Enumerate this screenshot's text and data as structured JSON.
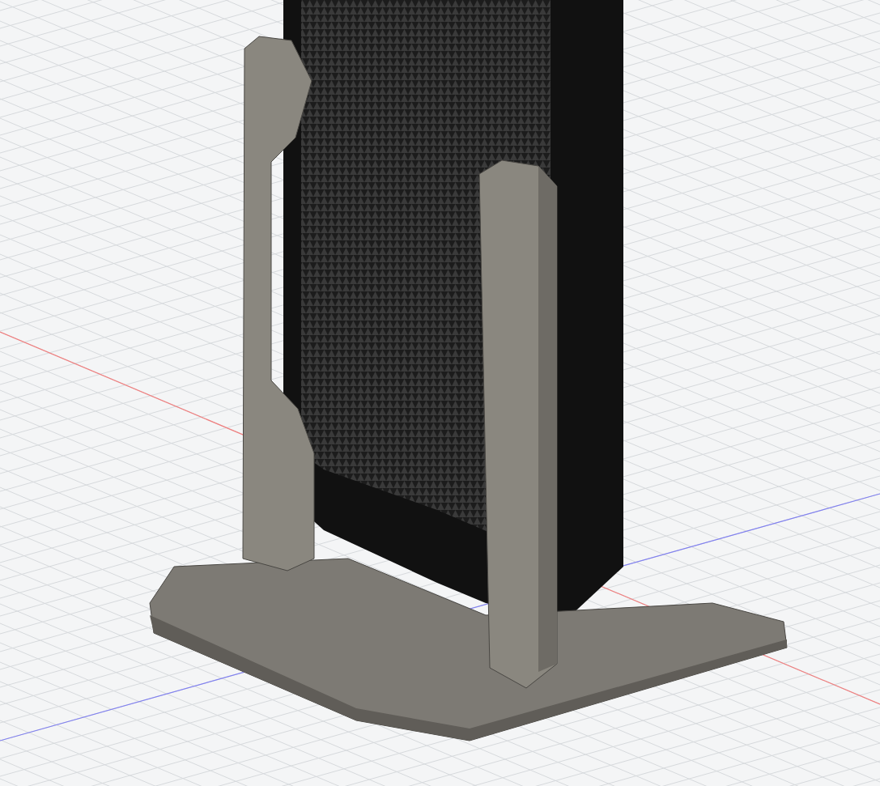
{
  "viewport": {
    "axes": [
      {
        "color": "#f08080"
      },
      {
        "color": "#8080f0"
      }
    ]
  }
}
